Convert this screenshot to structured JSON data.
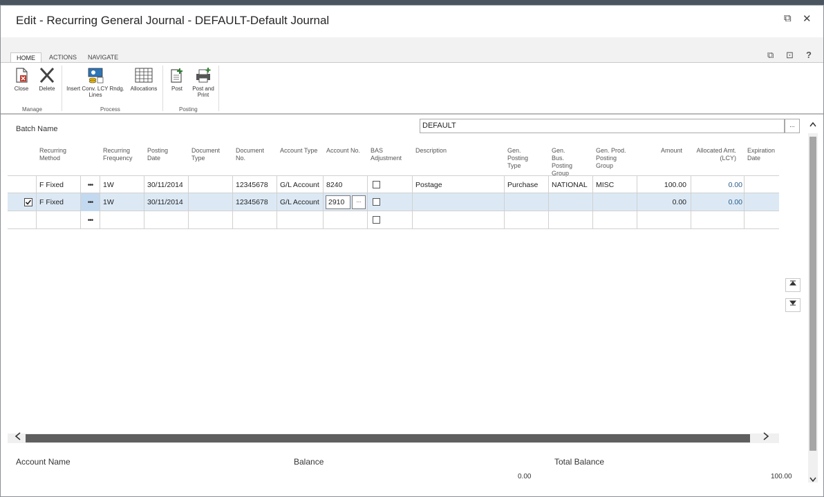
{
  "window": {
    "title": "Edit - Recurring General Journal - DEFAULT-Default Journal",
    "restore_glyph": "⧉",
    "close_glyph": "✕"
  },
  "ribbon": {
    "tabs": [
      "HOME",
      "ACTIONS",
      "NAVIGATE"
    ],
    "active_tab": "HOME",
    "right_icons": [
      "⧉",
      "⊡",
      "?"
    ],
    "buttons": {
      "close": "Close",
      "delete": "Delete",
      "insert_conv": "Insert Conv. LCY Rndg. Lines",
      "allocations": "Allocations",
      "post": "Post",
      "post_and_print": "Post and Print"
    },
    "groups": {
      "manage": "Manage",
      "process": "Process",
      "posting": "Posting"
    }
  },
  "batch": {
    "label": "Batch Name",
    "value": "DEFAULT",
    "assist": "..."
  },
  "columns": {
    "recurring_method": "Recurring Method",
    "recurring_frequency": "Recurring Frequency",
    "posting_date": "Posting Date",
    "document_type": "Document Type",
    "document_no": "Document No.",
    "account_type": "Account Type",
    "account_no": "Account No.",
    "bas_adjustment": "BAS Adjustment",
    "description": "Description",
    "gen_posting_type": "Gen. Posting Type",
    "gen_bus_posting_group": "Gen. Bus. Posting Group",
    "gen_prod_posting_group": "Gen. Prod. Posting Group",
    "amount": "Amount",
    "allocated_amt": "Allocated Amt. (LCY)",
    "expiration_date": "Expiration Date"
  },
  "rows": [
    {
      "recurring_method": "F Fixed",
      "recurring_frequency": "1W",
      "posting_date": "30/11/2014",
      "document_type": "",
      "document_no": "12345678",
      "account_type": "G/L Account",
      "account_no": "8240",
      "description": "Postage",
      "gen_posting_type": "Purchase",
      "gen_bus_posting_group": "NATIONAL",
      "gen_prod_posting_group": "MISC",
      "amount": "100.00",
      "allocated_amt": "0.00",
      "expiration_date": ""
    },
    {
      "recurring_method": "F Fixed",
      "recurring_frequency": "1W",
      "posting_date": "30/11/2014",
      "document_type": "",
      "document_no": "12345678",
      "account_type": "G/L Account",
      "account_no": "2910",
      "description": "",
      "gen_posting_type": "",
      "gen_bus_posting_group": "",
      "gen_prod_posting_group": "",
      "amount": "0.00",
      "allocated_amt": "0.00",
      "expiration_date": ""
    }
  ],
  "row_menu_glyph": "•••",
  "footer": {
    "account_name_label": "Account Name",
    "balance_label": "Balance",
    "balance_value": "0.00",
    "total_balance_label": "Total Balance",
    "total_balance_value": "100.00"
  }
}
